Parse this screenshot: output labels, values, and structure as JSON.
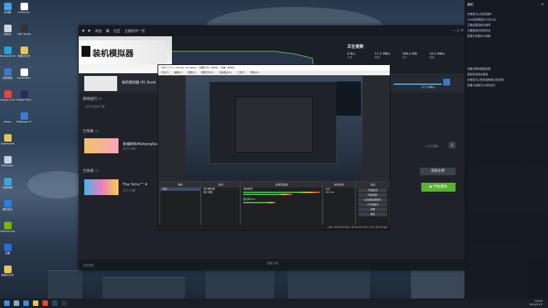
{
  "desktop": {
    "icons": [
      {
        "label": "此电脑",
        "color": "#4a9ee8"
      },
      {
        "label": "回收站",
        "color": "#cfd8e0"
      },
      {
        "label": "Microsoft Edge",
        "color": "#1fa5d8"
      },
      {
        "label": "控制面板",
        "color": "#3b78c8"
      },
      {
        "label": "Google Chrome",
        "color": "#e8463a"
      },
      {
        "label": "Steam",
        "color": "#2a4765"
      },
      {
        "label": "Downloads",
        "color": "#e9c45a"
      },
      {
        "label": "Wallpaper",
        "color": "#c7d3df"
      },
      {
        "label": "百度网盘",
        "color": "#3aa7e0"
      },
      {
        "label": "腾讯会议",
        "color": "#2c7be5"
      },
      {
        "label": "GeForce Experience",
        "color": "#76b900"
      },
      {
        "label": "迅雷",
        "color": "#2b6bd6"
      },
      {
        "label": "新建文件夹",
        "color": "#e9c45a"
      }
    ],
    "icons_col2": [
      {
        "label": "hamburg.",
        "color": "#ffffff"
      },
      {
        "label": "OBS Studio",
        "color": "#333333"
      },
      {
        "label": "新建文件夹",
        "color": "#e9c45a"
      },
      {
        "label": "LibreOffice",
        "color": "#ffffff"
      },
      {
        "label": "Adobe Premiere",
        "color": "#2b2a5c"
      },
      {
        "label": "Wallpaper Engine",
        "color": "#3b7bd1"
      }
    ]
  },
  "steam": {
    "nav": [
      "Steam",
      "商店",
      "库",
      "社区",
      "主播软件一览"
    ],
    "hero_logo": "装机模拟器",
    "updating_title": "正在更新",
    "stats": [
      {
        "value": "0 B/s",
        "label": "当前"
      },
      {
        "value": "17.2 MB/s",
        "label": "峰值"
      },
      {
        "value": "308.4 MB",
        "label": "总计"
      },
      {
        "value": "10.5 MB/s",
        "label": "磁盘"
      }
    ],
    "current_game": "装机模拟器 (PC Build",
    "progress_text": "27.5 MB/s",
    "in_progress": "即将进行",
    "in_progress_count": "(0)",
    "in_progress_sub": "队列中没有下载",
    "installed": "已安装",
    "installed_count": "(1)",
    "installed_game": "雀魂麻将(MahjongSoul)",
    "installed_size": "107.0 MB",
    "installed_status": "上次已更新",
    "completed": "已完成",
    "completed_count": "(1)",
    "completed_game": "The Sims™ 4",
    "completed_size": "371.3 MB",
    "clear_button": "清除全部",
    "play_button": "▶ 开始游戏",
    "footer_left": "添加游戏",
    "footer_center": "管理下载"
  },
  "obs": {
    "title": "OBS 27.0.1 (64-bit, windows) - 配置文件: 未命名 - 场景: 未命名",
    "menu": [
      "文件(F)",
      "编辑(E)",
      "视图(V)",
      "配置文件(P)",
      "场景集合(S)",
      "工具(T)",
      "帮助(H)"
    ],
    "panels": {
      "scenes": "场景",
      "sources": "来源",
      "mixer": "音频混音器",
      "transitions": "转场特效",
      "controls": "控制"
    },
    "scene_items": [
      "场景"
    ],
    "source_items": [
      "显示器采集",
      "窗口采集"
    ],
    "mixer_items": [
      "桌面音频",
      "麦克风/Aux"
    ],
    "transition_fade": "淡出",
    "transition_duration": "300 ms",
    "controls": [
      "开始推流",
      "开始录制",
      "启动虚拟摄像机",
      "工作室模式",
      "设置",
      "退出"
    ],
    "status": "LIVE: 00:00:00    REC: 00:00:00    CPU: 3.3%, 60.00 fps"
  },
  "notifications": {
    "header": "通知",
    "lines": [
      "在哪里可以找到录像？",
      "OBS录制视频太卡怎么办",
      "正确设置录制分辨率",
      "主播推流时如何优化",
      "配置文件备份与恢复",
      "场景切换快捷键设置",
      "录制完成保存路径",
      "在哪里可以更改录制格式和音频",
      "直播与录制可以同时进行"
    ]
  },
  "taskbar": {
    "time": "20:40",
    "date": "2021/11/7"
  }
}
